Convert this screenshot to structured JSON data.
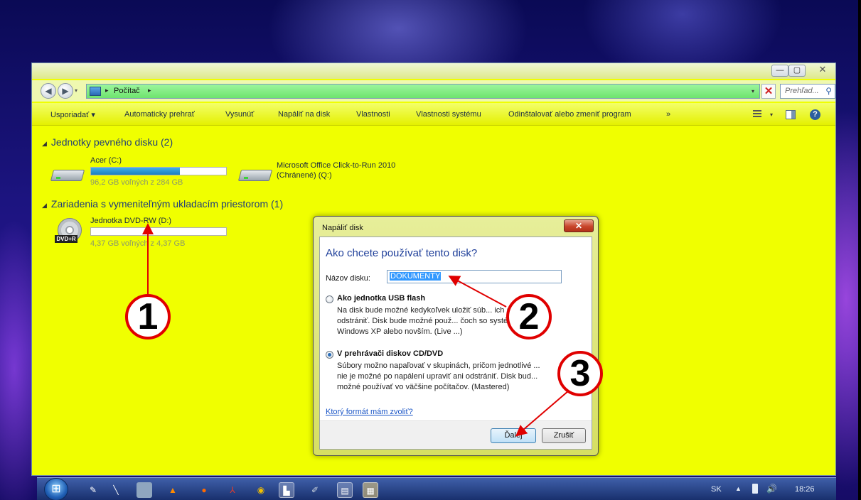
{
  "window": {
    "minimize": "—",
    "maximize": "▢",
    "close": "✕"
  },
  "address": {
    "crumb_root_sep": "▸",
    "crumb_computer": "Počítač",
    "crumb_end_sep": "▸",
    "search_placeholder": "Prehľad..."
  },
  "toolbar": {
    "organize": "Usporiadať ▾",
    "autoplay": "Automaticky prehrať",
    "eject": "Vysunúť",
    "burn": "Napáliť na disk",
    "properties": "Vlastnosti",
    "system_properties": "Vlastnosti systému",
    "uninstall": "Odinštalovať alebo zmeniť program",
    "more": "»"
  },
  "groups": {
    "hdd": {
      "header": "Jednotky pevného disku (2)",
      "drives": [
        {
          "name": "Acer (C:)",
          "free": "96,2 GB voľných z 284 GB",
          "used_fraction": 0.66
        },
        {
          "name": "Microsoft Office Click-to-Run 2010",
          "name_line2": "(Chránené) (Q:)"
        }
      ]
    },
    "removable": {
      "header": "Zariadenia s vymeniteľným ukladacím priestorom (1)",
      "drives": [
        {
          "name": "Jednotka DVD-RW (D:)",
          "free": "4,37 GB voľných z 4,37 GB",
          "badge": "DVD+R",
          "used_fraction": 0.0
        }
      ]
    }
  },
  "dialog": {
    "title": "Napáliť disk",
    "close": "✕",
    "heading": "Ako chcete používať tento disk?",
    "name_label": "Názov disku:",
    "name_value": "DOKUMENTY",
    "option_usb": {
      "title": "Ako jednotka USB flash",
      "desc": "Na disk bude možné kedykoľvek uložiť súb... ich alebo ich odstrániť. Disk bude možné použ... čoch so systémom Windows XP alebo novším. (Live ...)"
    },
    "option_cd": {
      "title": "V prehrávači diskov CD/DVD",
      "desc": "Súbory možno napaľovať v skupinách, pričom jednotlivé ... nie je možné po napálení upraviť ani odstrániť. Disk bud... možné používať vo väčšine počítačov. (Mastered)"
    },
    "link": "Ktorý formát mám zvoliť?",
    "next_button": "Ďalej",
    "cancel_button": "Zrušiť"
  },
  "callouts": {
    "one": "1",
    "two": "2",
    "three": "3"
  },
  "taskbar": {
    "start": "⊞",
    "language": "SK",
    "tray_up": "▲",
    "sound": "🔊",
    "clock": "18:26"
  },
  "colors": {
    "window_bg": "#f0ff00",
    "address_bg": "#7ee87e",
    "callout_ring": "#e00000",
    "arrow": "#e00000",
    "link": "#1a55c6"
  }
}
